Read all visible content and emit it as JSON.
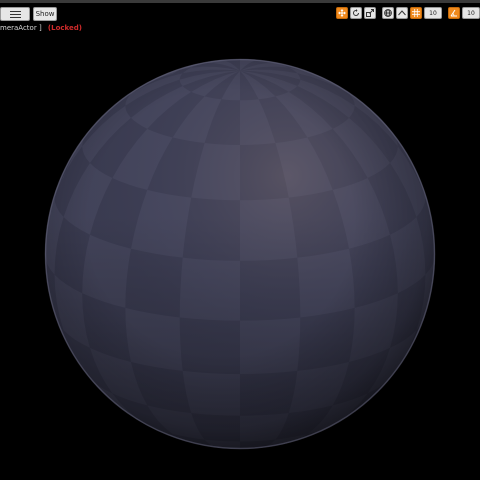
{
  "toolbar": {
    "show_label": "Show",
    "snap_values": {
      "grid": "10",
      "rotation": "10"
    }
  },
  "viewport": {
    "camera_actor_label": "meraActor ]",
    "locked_label": "(Locked)"
  },
  "colors": {
    "background": "#000000",
    "accent_orange": "#f08a1d",
    "locked_red": "#d02b2b",
    "material_base": "#3b3c52",
    "material_tile_dark": "#33344a",
    "material_tile_light": "#44455c"
  },
  "icons": {
    "menu": "hamburger-icon",
    "translate": "move-icon",
    "rotate": "rotate-icon",
    "scale": "scale-icon",
    "world": "globe-icon",
    "grid_snap": "grid-snap-icon",
    "rotation_snap": "angle-snap-icon"
  }
}
